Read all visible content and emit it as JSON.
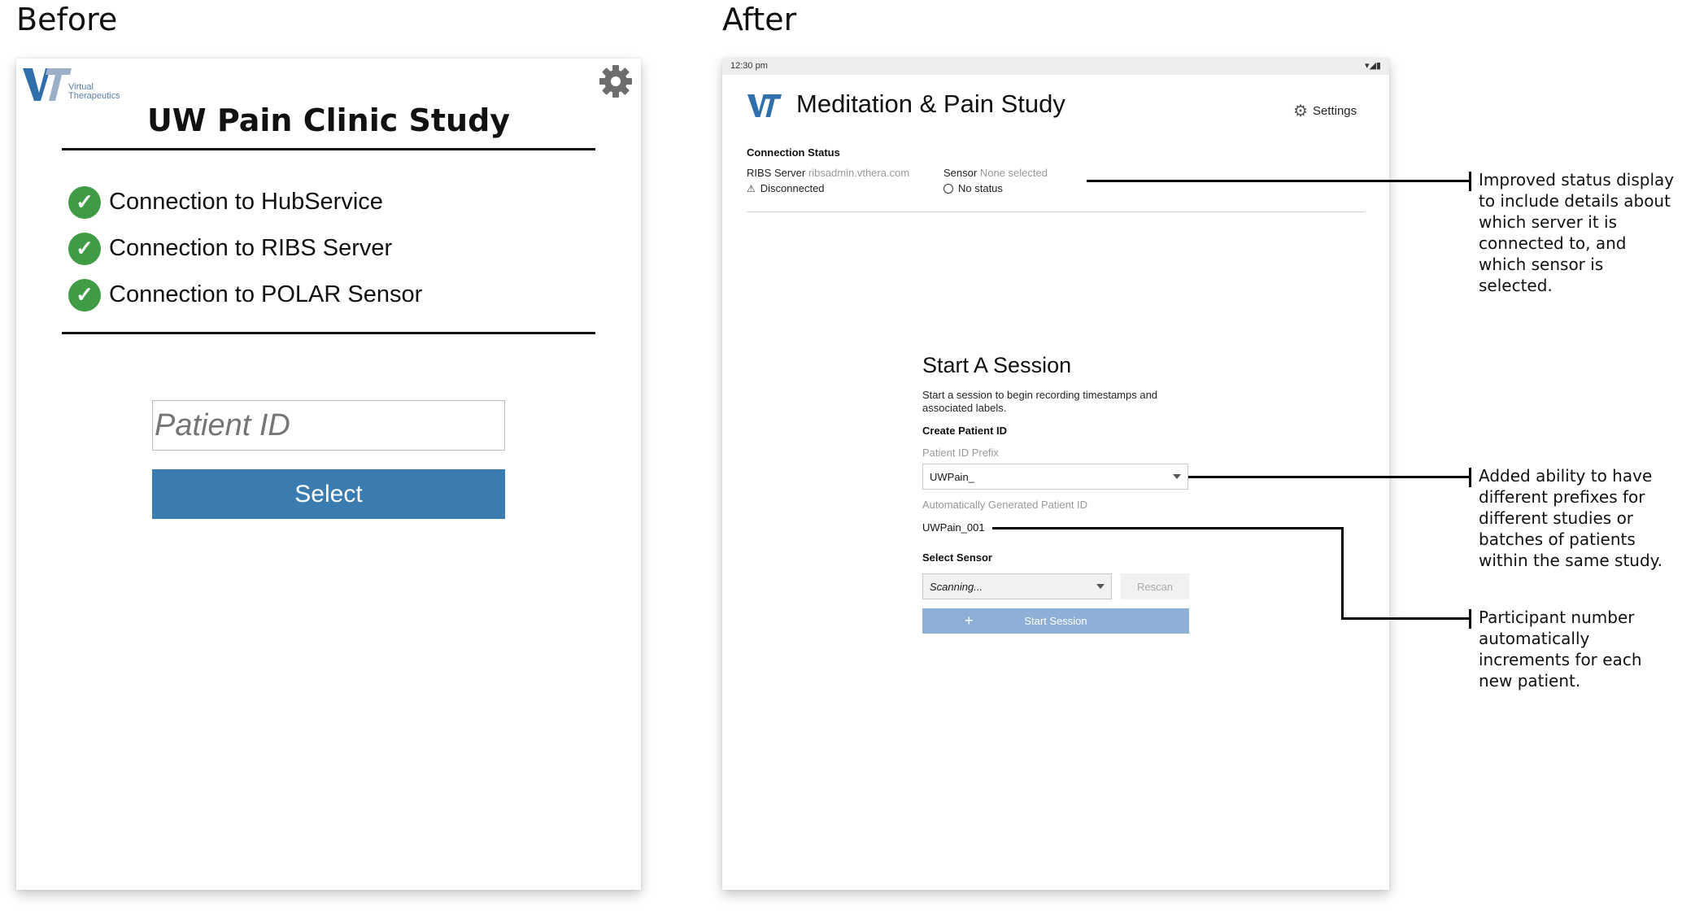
{
  "before": {
    "heading": "Before",
    "logo": {
      "company_line1": "Virtual",
      "company_line2": "Therapeutics"
    },
    "title": "UW Pain Clinic Study",
    "connections": [
      {
        "label": "Connection to HubService",
        "status": "check"
      },
      {
        "label": "Connection to RIBS Server",
        "status": "check"
      },
      {
        "label": "Connection to POLAR Sensor",
        "status": "check"
      }
    ],
    "patient_id_placeholder": "Patient ID",
    "select_button": "Select"
  },
  "after": {
    "heading": "After",
    "status_bar": {
      "time": "12:30 pm"
    },
    "title": "Meditation & Pain Study",
    "settings_label": "Settings",
    "connection_status": {
      "title": "Connection Status",
      "ribs_label": "RIBS Server",
      "ribs_value": "ribsadmin.vthera.com",
      "ribs_status": "Disconnected",
      "sensor_label": "Sensor",
      "sensor_value": "None selected",
      "sensor_status": "No status"
    },
    "session": {
      "title": "Start A Session",
      "description": "Start a session to begin recording timestamps and associated labels.",
      "create_patient_id": "Create Patient ID",
      "prefix_label": "Patient ID Prefix",
      "prefix_value": "UWPain_",
      "auto_label": "Automatically Generated Patient ID",
      "auto_value": "UWPain_001",
      "select_sensor": "Select Sensor",
      "sensor_dropdown": "Scanning...",
      "rescan": "Rescan",
      "start_plus": "+",
      "start_session": "Start Session"
    }
  },
  "annotations": [
    "Improved status display to include details about which server it is connected to, and which sensor is selected.",
    "Added ability to have different prefixes for different studies or batches of patients within the same study.",
    "Participant number automatically increments for each new patient."
  ],
  "colors": {
    "select_button": "#3a7cb0",
    "start_button": "#8fb0d6",
    "check_green": "#3f9b46",
    "logo_blue": "#2f6fab"
  }
}
